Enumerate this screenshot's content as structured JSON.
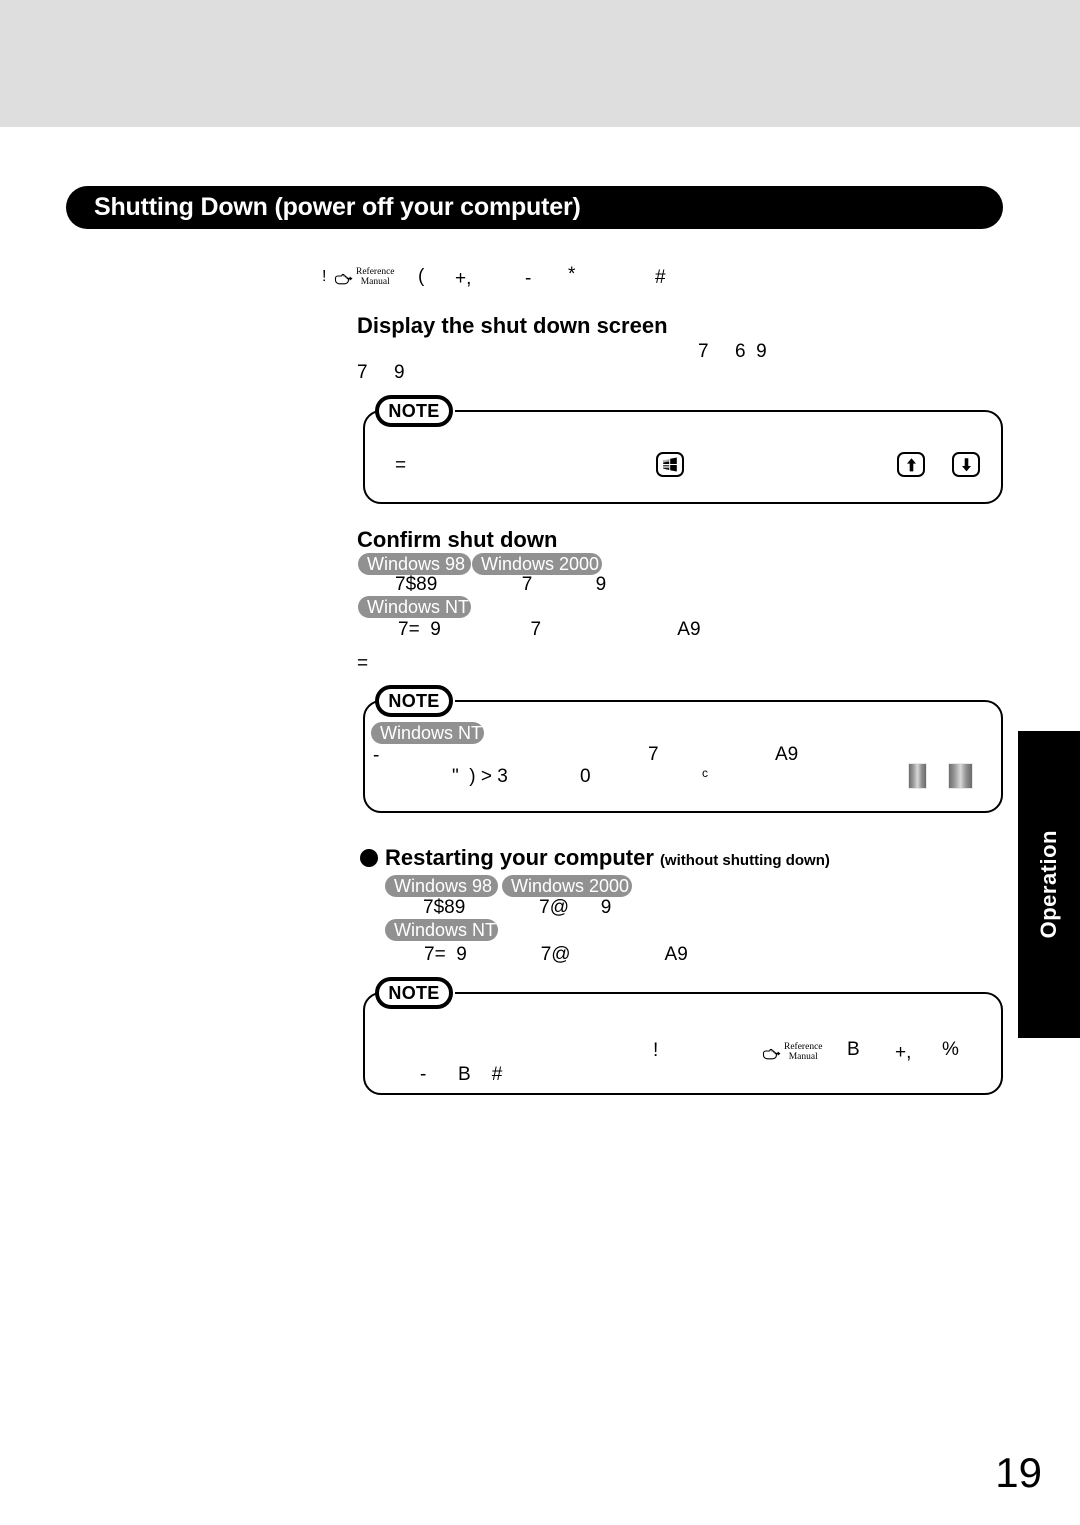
{
  "page": {
    "number": "19",
    "side_tab_label": "Operation",
    "title": "Shutting Down (power off your computer)"
  },
  "intro_line": {
    "lead_glyph": "!",
    "ref_icon": "pointing-hand-icon",
    "ref_label_line1": "Reference",
    "ref_label_line2": "Manual",
    "glyph_a": "(",
    "glyph_b": "+,",
    "glyph_c": "-",
    "glyph_d": "*",
    "glyph_e": "#"
  },
  "section_display": {
    "heading": "Display the shut down screen",
    "glyph_right": "7     6  9",
    "glyph_left": "7     9"
  },
  "note1": {
    "badge": "NOTE",
    "glyph_left": "=",
    "key_windows": "windows-logo-key-icon",
    "key_up": "arrow-up-key-icon",
    "key_down": "arrow-down-key-icon"
  },
  "section_confirm": {
    "heading": "Confirm shut down",
    "badges_row1": [
      "Windows 98",
      "Windows 2000"
    ],
    "glyph_row1": "7$89                7            9",
    "badges_row2": [
      "Windows NT"
    ],
    "glyph_row2": "7=  9                 7                          A9",
    "glyph_row3": "="
  },
  "note2": {
    "badge": "NOTE",
    "os_badge": "Windows NT",
    "glyph_line1_left": "-",
    "glyph_line1_mid": "7",
    "glyph_line1_right": "A9",
    "glyph_line2_a": "\"  ) > 3",
    "glyph_line2_b": "0",
    "glyph_line2_c": "c",
    "bar_left": "gradient-bar-graphic",
    "bar_right": "gradient-bar-graphic"
  },
  "section_restart": {
    "heading_main": "Restarting your computer",
    "heading_sub": "(without shutting down)",
    "badges_row1": [
      "Windows 98",
      "Windows 2000"
    ],
    "glyph_row1": "7$89              7@      9",
    "badges_row2": [
      "Windows NT"
    ],
    "glyph_row2": "7=  9              7@                  A9"
  },
  "note3": {
    "badge": "NOTE",
    "glyph_exclaim": "!",
    "ref_icon": "pointing-hand-icon",
    "ref_label_line1": "Reference",
    "ref_label_line2": "Manual",
    "glyph_b": "B",
    "glyph_c": "+,",
    "glyph_d": "%",
    "glyph_line2": "-      B    #"
  },
  "colors": {
    "top_band": "#dedede",
    "title_bar": "#000000",
    "os_badge": "#919191",
    "side_tab": "#000000",
    "text": "#000000"
  }
}
